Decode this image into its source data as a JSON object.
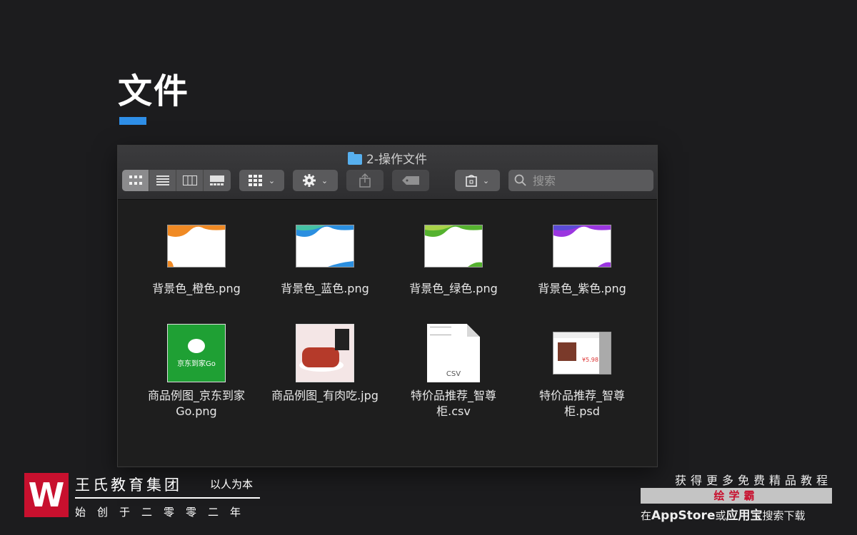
{
  "slide": {
    "title": "文件"
  },
  "window": {
    "title": "2-操作文件"
  },
  "toolbar": {
    "view_icons": [
      "icon-view-icon",
      "list-view-icon",
      "column-view-icon",
      "gallery-view-icon"
    ],
    "chevron": "⌄",
    "search_placeholder": "搜索"
  },
  "files": [
    {
      "name": "背景色_橙色.png",
      "kind": "orange"
    },
    {
      "name": "背景色_蓝色.png",
      "kind": "blue"
    },
    {
      "name": "背景色_绿色.png",
      "kind": "green"
    },
    {
      "name": "背景色_紫色.png",
      "kind": "purple"
    },
    {
      "name": "商品例图_京东到家Go.png",
      "kind": "jd"
    },
    {
      "name": "商品例图_有肉吃.jpg",
      "kind": "food"
    },
    {
      "name": "特价品推荐_智尊柜.csv",
      "kind": "csv"
    },
    {
      "name": "特价品推荐_智尊柜.psd",
      "kind": "psd"
    }
  ],
  "thumb_text": {
    "jd": "京东到家Go",
    "csv_ext": "CSV",
    "psd_price": "¥5.98"
  },
  "colors": {
    "orange": "#f08a24",
    "blue": "#2b8fe0",
    "green": "#55b22f",
    "purple": "#9b36e0",
    "accent": "#2f8fe8",
    "brand_red": "#c8102e"
  },
  "footer": {
    "logo_letter": "W",
    "org_name": "王氏教育集团",
    "motto": "以人为本",
    "since": "始创于二零零二年",
    "promo_top": "获得更多免费精品教程",
    "promo_brand": "绘学霸",
    "promo_bottom_pre": "在",
    "promo_appstore": "AppStore",
    "promo_mid": "或",
    "promo_yyb": "应用宝",
    "promo_post": "搜索下载"
  }
}
